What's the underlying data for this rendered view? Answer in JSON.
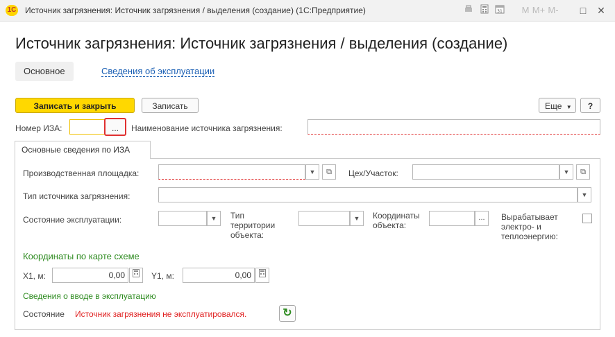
{
  "window": {
    "logo_text": "1С",
    "title": "Источник загрязнения: Источник загрязнения / выделения (создание)  (1С:Предприятие)",
    "icons": {
      "m": "M",
      "mplus": "M+",
      "mminus": "M-",
      "restore": "□",
      "close": "✕"
    }
  },
  "form": {
    "title": "Источник загрязнения: Источник загрязнения / выделения (создание)",
    "tabs": {
      "main": "Основное",
      "operation": "Сведения об эксплуатации"
    },
    "buttons": {
      "write_close": "Записать и закрыть",
      "write": "Записать",
      "more": "Еще",
      "help": "?"
    },
    "iza_label": "Номер ИЗА:",
    "iza_value": "",
    "choose_btn": "...",
    "source_name_label": "Наименование источника загрязнения:",
    "source_name_value": ""
  },
  "group": {
    "tab_label": "Основные сведения по ИЗА",
    "site_label": "Производственная площадка:",
    "site_value": "",
    "workshop_label": "Цех/Участок:",
    "workshop_value": "",
    "source_type_label": "Тип источника загрязнения:",
    "source_type_value": "",
    "state_label": "Состояние эксплуатации:",
    "territory_label": "Тип территории объекта:",
    "coords_label": "Координаты объекта:",
    "energy_label": "Вырабатывает электро- и теплоэнергию:",
    "energy_checked": false,
    "map_coords_header": "Координаты по карте схеме",
    "x1_label": "X1, м:",
    "x1_value": "0,00",
    "y1_label": "Y1, м:",
    "y1_value": "0,00",
    "commission_header": "Сведения о вводе в эксплуатацию",
    "status_label": "Состояние",
    "status_value": "Источник загрязнения не эксплуатировался."
  }
}
